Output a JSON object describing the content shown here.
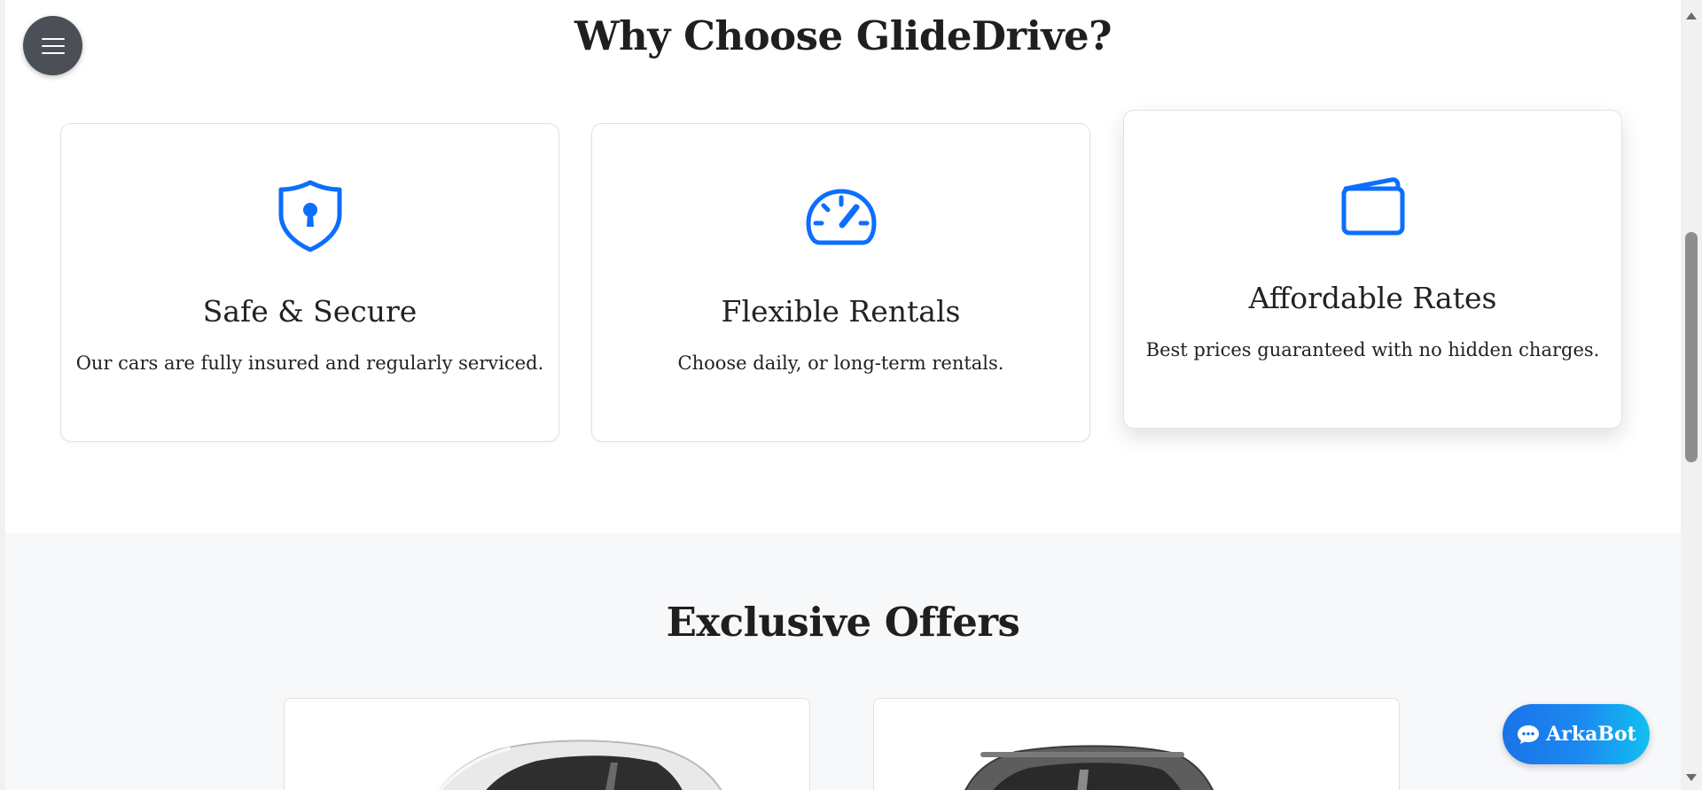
{
  "header": {
    "menu_icon": "hamburger-menu-icon"
  },
  "features": {
    "title": "Why Choose GlideDrive?",
    "items": [
      {
        "icon": "shield-lock-icon",
        "title": "Safe & Secure",
        "description": "Our cars are fully insured and regularly serviced."
      },
      {
        "icon": "speedometer-icon",
        "title": "Flexible Rentals",
        "description": "Choose daily, or long-term rentals."
      },
      {
        "icon": "wallet-icon",
        "title": "Affordable Rates",
        "description": "Best prices guaranteed with no hidden charges."
      }
    ]
  },
  "offers": {
    "title": "Exclusive Offers",
    "cards": [
      {
        "image": "white-sedan-car-image"
      },
      {
        "image": "grey-suv-car-image"
      }
    ]
  },
  "chat": {
    "label": "ArkaBot",
    "icon": "chat-bubble-icon"
  },
  "colors": {
    "accent": "#0d6efd",
    "menu_button": "#4a5055",
    "chat_gradient_start": "#1a73e8",
    "chat_gradient_end": "#11c1f0",
    "offers_background": "#f7f8fa"
  }
}
